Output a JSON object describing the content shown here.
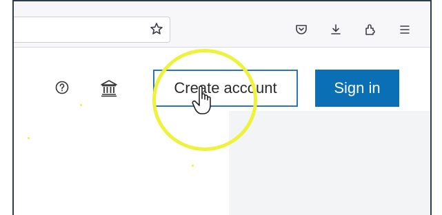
{
  "toolbar": {
    "icons": [
      "star-icon",
      "pocket-icon",
      "download-icon",
      "extensions-icon",
      "menu-icon"
    ]
  },
  "header": {
    "help_icon": "question-circle-icon",
    "institution_icon": "institution-icon",
    "create_account_label": "Create account",
    "sign_in_label": "Sign in"
  },
  "colors": {
    "primary": "#0a6fb5",
    "create_border": "#2b74b8",
    "highlight": "#eef23a",
    "toolbar_bg": "#f7f7f9"
  }
}
